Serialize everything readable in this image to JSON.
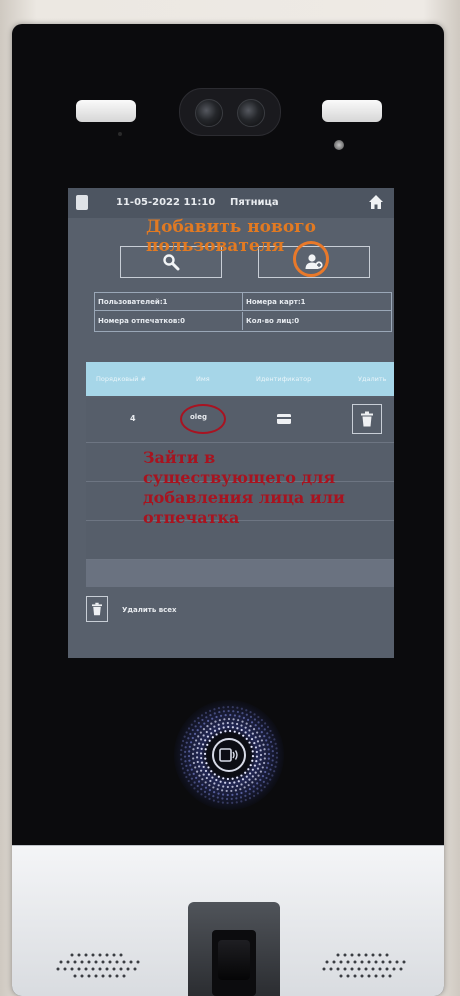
{
  "status": {
    "datetime": "11-05-2022 11:10",
    "weekday": "Пятница"
  },
  "annotations": {
    "add_user": "Добавить нового\nпользователя",
    "open_existing": "Зайти в\nсуществующего для\nдобавления лица или\nотпечатка",
    "add_color": "#e27a22",
    "open_color": "#a8131f"
  },
  "toolbar": {
    "search_icon": "search-icon",
    "add_user_icon": "add-user-icon"
  },
  "stats": {
    "users": "Пользователей:1",
    "cards": "Номера карт:1",
    "fingerprints": "Номера отпечатков:0",
    "faces": "Кол-во лиц:0"
  },
  "table": {
    "columns": [
      "Порядковый #",
      "Имя",
      "Идентификатор",
      "Удалить"
    ],
    "rows": [
      {
        "number": "4",
        "name": "oleg"
      }
    ]
  },
  "footer": {
    "delete_all": "Удалить всех"
  }
}
